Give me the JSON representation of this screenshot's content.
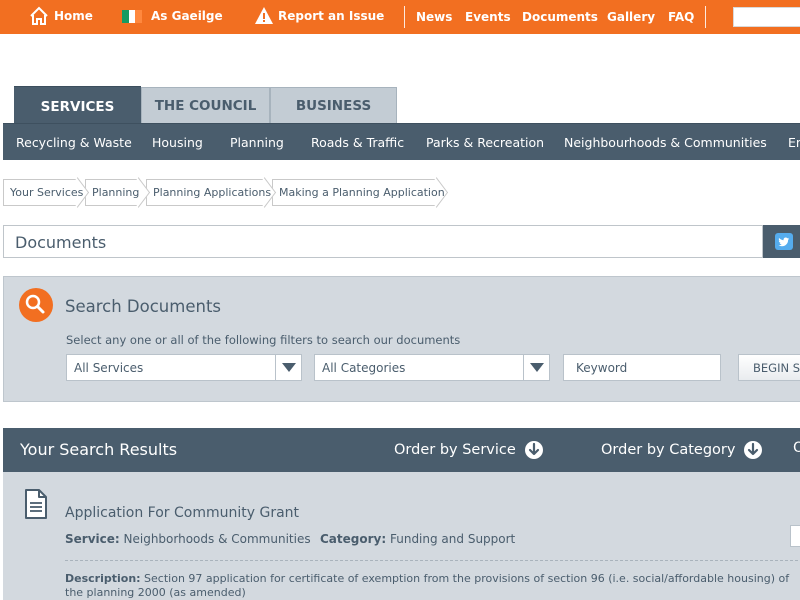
{
  "topbar": {
    "home": "Home",
    "gaeilge": "As Gaeilge",
    "report": "Report an Issue",
    "links": [
      "News",
      "Events",
      "Documents",
      "Gallery",
      "FAQ"
    ]
  },
  "tabs": [
    "SERVICES",
    "THE COUNCIL",
    "BUSINESS"
  ],
  "subnav": [
    "Recycling & Waste",
    "Housing",
    "Planning",
    "Roads & Traffic",
    "Parks & Recreation",
    "Neighbourhoods & Communities",
    "En"
  ],
  "breadcrumb": [
    "Your Services",
    "Planning",
    "Planning Applications",
    "Making a Planning Application"
  ],
  "documents": {
    "title": "Documents",
    "tweet_label": "T"
  },
  "search": {
    "title": "Search Documents",
    "subtitle": "Select any one or all of the following filters to search our documents",
    "service_select": "All Services",
    "category_select": "All Categories",
    "keyword_placeholder": "Keyword",
    "begin_label": "BEGIN SEA"
  },
  "results": {
    "title": "Your Search Results",
    "order_service": "Order by Service",
    "order_category": "Order by Category",
    "order_more": "O"
  },
  "result_item": {
    "title": "Application For Community Grant",
    "service_label": "Service:",
    "service_value": "Neighborhoods & Communities",
    "category_label": "Category:",
    "category_value": "Funding and Support",
    "description_label": "Description:",
    "description_value": "Section 97 application for  certificate of exemption from the provisions of section 96 (i.e. social/affordable housing) of the planning 2000 (as amended)"
  },
  "colors": {
    "orange": "#f26f21",
    "slate": "#4a5d6d",
    "panel": "#d3d9df"
  }
}
